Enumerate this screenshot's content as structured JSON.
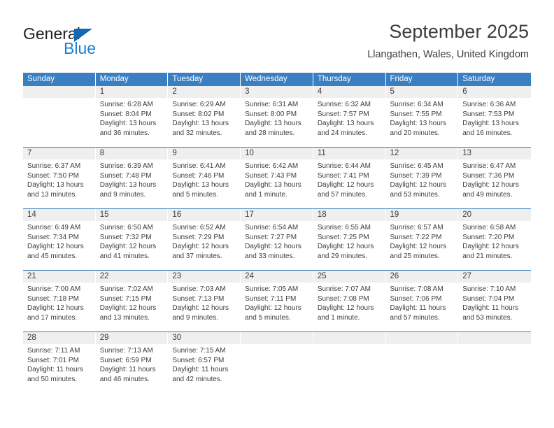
{
  "brand": {
    "name_top": "General",
    "name_bottom": "Blue",
    "triangle_color": "#1268b3",
    "top_color": "#231f20",
    "bottom_color": "#1a7fd4"
  },
  "header": {
    "title": "September 2025",
    "subtitle": "Llangathen, Wales, United Kingdom"
  },
  "theme": {
    "header_blue": "#3a7fc1",
    "day_band_gray": "#efefef",
    "text_gray": "#3d3d3d"
  },
  "weekdays": [
    "Sunday",
    "Monday",
    "Tuesday",
    "Wednesday",
    "Thursday",
    "Friday",
    "Saturday"
  ],
  "weeks": [
    [
      {
        "day": "",
        "sunrise": "",
        "sunset": "",
        "daylight": "",
        "empty": true
      },
      {
        "day": "1",
        "sunrise": "Sunrise: 6:28 AM",
        "sunset": "Sunset: 8:04 PM",
        "daylight": "Daylight: 13 hours and 36 minutes."
      },
      {
        "day": "2",
        "sunrise": "Sunrise: 6:29 AM",
        "sunset": "Sunset: 8:02 PM",
        "daylight": "Daylight: 13 hours and 32 minutes."
      },
      {
        "day": "3",
        "sunrise": "Sunrise: 6:31 AM",
        "sunset": "Sunset: 8:00 PM",
        "daylight": "Daylight: 13 hours and 28 minutes."
      },
      {
        "day": "4",
        "sunrise": "Sunrise: 6:32 AM",
        "sunset": "Sunset: 7:57 PM",
        "daylight": "Daylight: 13 hours and 24 minutes."
      },
      {
        "day": "5",
        "sunrise": "Sunrise: 6:34 AM",
        "sunset": "Sunset: 7:55 PM",
        "daylight": "Daylight: 13 hours and 20 minutes."
      },
      {
        "day": "6",
        "sunrise": "Sunrise: 6:36 AM",
        "sunset": "Sunset: 7:53 PM",
        "daylight": "Daylight: 13 hours and 16 minutes."
      }
    ],
    [
      {
        "day": "7",
        "sunrise": "Sunrise: 6:37 AM",
        "sunset": "Sunset: 7:50 PM",
        "daylight": "Daylight: 13 hours and 13 minutes."
      },
      {
        "day": "8",
        "sunrise": "Sunrise: 6:39 AM",
        "sunset": "Sunset: 7:48 PM",
        "daylight": "Daylight: 13 hours and 9 minutes."
      },
      {
        "day": "9",
        "sunrise": "Sunrise: 6:41 AM",
        "sunset": "Sunset: 7:46 PM",
        "daylight": "Daylight: 13 hours and 5 minutes."
      },
      {
        "day": "10",
        "sunrise": "Sunrise: 6:42 AM",
        "sunset": "Sunset: 7:43 PM",
        "daylight": "Daylight: 13 hours and 1 minute."
      },
      {
        "day": "11",
        "sunrise": "Sunrise: 6:44 AM",
        "sunset": "Sunset: 7:41 PM",
        "daylight": "Daylight: 12 hours and 57 minutes."
      },
      {
        "day": "12",
        "sunrise": "Sunrise: 6:45 AM",
        "sunset": "Sunset: 7:39 PM",
        "daylight": "Daylight: 12 hours and 53 minutes."
      },
      {
        "day": "13",
        "sunrise": "Sunrise: 6:47 AM",
        "sunset": "Sunset: 7:36 PM",
        "daylight": "Daylight: 12 hours and 49 minutes."
      }
    ],
    [
      {
        "day": "14",
        "sunrise": "Sunrise: 6:49 AM",
        "sunset": "Sunset: 7:34 PM",
        "daylight": "Daylight: 12 hours and 45 minutes."
      },
      {
        "day": "15",
        "sunrise": "Sunrise: 6:50 AM",
        "sunset": "Sunset: 7:32 PM",
        "daylight": "Daylight: 12 hours and 41 minutes."
      },
      {
        "day": "16",
        "sunrise": "Sunrise: 6:52 AM",
        "sunset": "Sunset: 7:29 PM",
        "daylight": "Daylight: 12 hours and 37 minutes."
      },
      {
        "day": "17",
        "sunrise": "Sunrise: 6:54 AM",
        "sunset": "Sunset: 7:27 PM",
        "daylight": "Daylight: 12 hours and 33 minutes."
      },
      {
        "day": "18",
        "sunrise": "Sunrise: 6:55 AM",
        "sunset": "Sunset: 7:25 PM",
        "daylight": "Daylight: 12 hours and 29 minutes."
      },
      {
        "day": "19",
        "sunrise": "Sunrise: 6:57 AM",
        "sunset": "Sunset: 7:22 PM",
        "daylight": "Daylight: 12 hours and 25 minutes."
      },
      {
        "day": "20",
        "sunrise": "Sunrise: 6:58 AM",
        "sunset": "Sunset: 7:20 PM",
        "daylight": "Daylight: 12 hours and 21 minutes."
      }
    ],
    [
      {
        "day": "21",
        "sunrise": "Sunrise: 7:00 AM",
        "sunset": "Sunset: 7:18 PM",
        "daylight": "Daylight: 12 hours and 17 minutes."
      },
      {
        "day": "22",
        "sunrise": "Sunrise: 7:02 AM",
        "sunset": "Sunset: 7:15 PM",
        "daylight": "Daylight: 12 hours and 13 minutes."
      },
      {
        "day": "23",
        "sunrise": "Sunrise: 7:03 AM",
        "sunset": "Sunset: 7:13 PM",
        "daylight": "Daylight: 12 hours and 9 minutes."
      },
      {
        "day": "24",
        "sunrise": "Sunrise: 7:05 AM",
        "sunset": "Sunset: 7:11 PM",
        "daylight": "Daylight: 12 hours and 5 minutes."
      },
      {
        "day": "25",
        "sunrise": "Sunrise: 7:07 AM",
        "sunset": "Sunset: 7:08 PM",
        "daylight": "Daylight: 12 hours and 1 minute."
      },
      {
        "day": "26",
        "sunrise": "Sunrise: 7:08 AM",
        "sunset": "Sunset: 7:06 PM",
        "daylight": "Daylight: 11 hours and 57 minutes."
      },
      {
        "day": "27",
        "sunrise": "Sunrise: 7:10 AM",
        "sunset": "Sunset: 7:04 PM",
        "daylight": "Daylight: 11 hours and 53 minutes."
      }
    ],
    [
      {
        "day": "28",
        "sunrise": "Sunrise: 7:11 AM",
        "sunset": "Sunset: 7:01 PM",
        "daylight": "Daylight: 11 hours and 50 minutes."
      },
      {
        "day": "29",
        "sunrise": "Sunrise: 7:13 AM",
        "sunset": "Sunset: 6:59 PM",
        "daylight": "Daylight: 11 hours and 46 minutes."
      },
      {
        "day": "30",
        "sunrise": "Sunrise: 7:15 AM",
        "sunset": "Sunset: 6:57 PM",
        "daylight": "Daylight: 11 hours and 42 minutes."
      },
      {
        "day": "",
        "sunrise": "",
        "sunset": "",
        "daylight": "",
        "empty": true
      },
      {
        "day": "",
        "sunrise": "",
        "sunset": "",
        "daylight": "",
        "empty": true
      },
      {
        "day": "",
        "sunrise": "",
        "sunset": "",
        "daylight": "",
        "empty": true
      },
      {
        "day": "",
        "sunrise": "",
        "sunset": "",
        "daylight": "",
        "empty": true
      }
    ]
  ]
}
